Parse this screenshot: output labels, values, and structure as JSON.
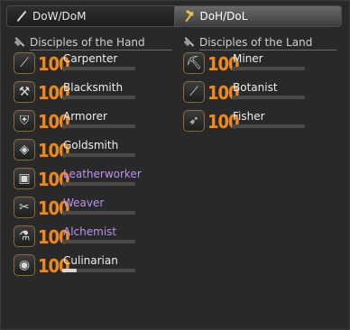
{
  "tabs": [
    {
      "label": "DoW/DoM",
      "icon": "sword-icon",
      "active": false
    },
    {
      "label": "DoH/DoL",
      "icon": "pickaxe-icon",
      "active": true
    }
  ],
  "hand": {
    "title": "Disciples of the Hand",
    "jobs": [
      {
        "name": "Carpenter",
        "level": "100",
        "glyph": "⟋",
        "exp": 0,
        "name_color": "white"
      },
      {
        "name": "Blacksmith",
        "level": "100",
        "glyph": "⚒",
        "exp": 0,
        "name_color": "white"
      },
      {
        "name": "Armorer",
        "level": "100",
        "glyph": "⛨",
        "exp": 0,
        "name_color": "white"
      },
      {
        "name": "Goldsmith",
        "level": "100",
        "glyph": "◈",
        "exp": 0,
        "name_color": "white"
      },
      {
        "name": "Leatherworker",
        "level": "100",
        "glyph": "▣",
        "exp": 0,
        "name_color": "purple"
      },
      {
        "name": "Weaver",
        "level": "100",
        "glyph": "✂",
        "exp": 0,
        "name_color": "purple"
      },
      {
        "name": "Alchemist",
        "level": "100",
        "glyph": "⚗",
        "exp": 0,
        "name_color": "purple"
      },
      {
        "name": "Culinarian",
        "level": "100",
        "glyph": "◉",
        "exp": 0.2,
        "name_color": "white"
      }
    ]
  },
  "land": {
    "title": "Disciples of the Land",
    "jobs": [
      {
        "name": "Miner",
        "level": "100",
        "glyph": "⛏",
        "exp": 0,
        "name_color": "white"
      },
      {
        "name": "Botanist",
        "level": "100",
        "glyph": "⟋",
        "exp": 0,
        "name_color": "white"
      },
      {
        "name": "Fisher",
        "level": "100",
        "glyph": "➶",
        "exp": 0,
        "name_color": "white"
      }
    ]
  }
}
